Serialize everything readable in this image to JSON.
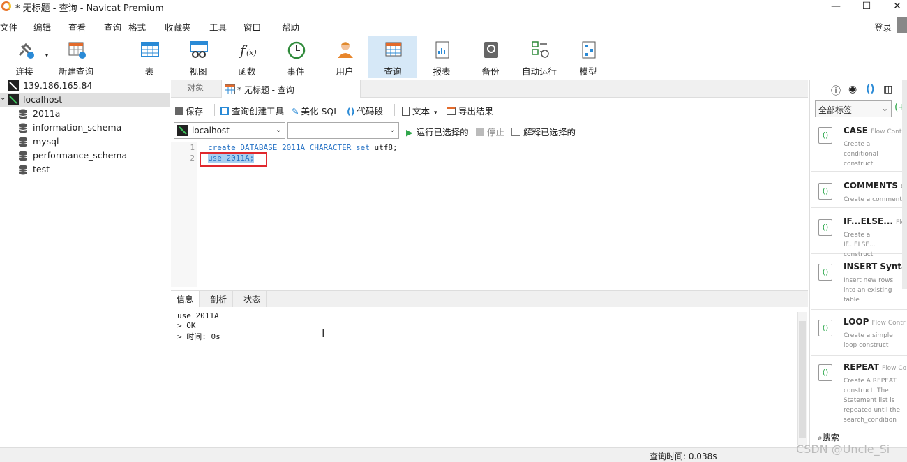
{
  "window": {
    "title": "* 无标题 - 查询 - Navicat Premium",
    "min_glyph": "—",
    "max_glyph": "☐",
    "close_glyph": "✕"
  },
  "menu": [
    "文件",
    "编辑",
    "查看",
    "查询",
    "格式",
    "收藏夹",
    "工具",
    "窗口",
    "帮助"
  ],
  "login_label": "登录",
  "toolbar": [
    {
      "label": "连接",
      "icon": "plug-icon"
    },
    {
      "label": "新建查询",
      "icon": "new-query-icon"
    },
    {
      "label": "表",
      "icon": "table-icon"
    },
    {
      "label": "视图",
      "icon": "view-icon"
    },
    {
      "label": "函数",
      "icon": "function-icon"
    },
    {
      "label": "事件",
      "icon": "clock-icon"
    },
    {
      "label": "用户",
      "icon": "user-icon"
    },
    {
      "label": "查询",
      "icon": "query-icon",
      "active": true
    },
    {
      "label": "报表",
      "icon": "report-icon"
    },
    {
      "label": "备份",
      "icon": "backup-icon"
    },
    {
      "label": "自动运行",
      "icon": "automation-icon"
    },
    {
      "label": "模型",
      "icon": "model-icon"
    }
  ],
  "tree": {
    "connections": [
      "139.186.165.84",
      "localhost"
    ],
    "databases": [
      "2011a",
      "information_schema",
      "mysql",
      "performance_schema",
      "test"
    ]
  },
  "tabs": {
    "objects": "对象",
    "query": "* 无标题 - 查询"
  },
  "editor_toolbar": {
    "save": "保存",
    "builder": "查询创建工具",
    "beautify": "美化 SQL",
    "snippet": "代码段",
    "text": "文本",
    "export": "导出结果"
  },
  "run_bar": {
    "connection": "localhost",
    "database": "",
    "run": "运行已选择的",
    "stop": "停止",
    "explain": "解释已选择的"
  },
  "code": {
    "lines": [
      "1",
      "2"
    ],
    "line1": {
      "kw1": "create",
      "kw2": "DATABASE",
      "name": "2011A",
      "kw3": "CHARACTER",
      "kw4": "set",
      "rest": "utf8;"
    },
    "line2": "use 2011A;"
  },
  "result_tabs": [
    "信息",
    "剖析",
    "状态"
  ],
  "messages": [
    "use 2011A",
    "> OK",
    "> 时间: 0s"
  ],
  "status": {
    "query_time": "查询时间: 0.038s"
  },
  "right_panel": {
    "tag_filter": "全部标签",
    "search": "搜索",
    "snippets": [
      {
        "name": "CASE",
        "tag": "Flow Contr",
        "desc": "Create a conditional construct"
      },
      {
        "name": "COMMENTS",
        "tag": "C",
        "desc": "Create a comment"
      },
      {
        "name": "IF...ELSE...",
        "tag": "Flow",
        "desc": "Create a IF...ELSE... construct"
      },
      {
        "name": "INSERT Syntax",
        "tag": "",
        "desc": "Insert new rows into an existing table"
      },
      {
        "name": "LOOP",
        "tag": "Flow Contr",
        "desc": "Create a simple loop construct"
      },
      {
        "name": "REPEAT",
        "tag": "Flow Co",
        "desc": "Create A REPEAT construct. The Statement list is repeated until the search_condition"
      }
    ]
  },
  "watermark": "CSDN @Uncle_Si"
}
